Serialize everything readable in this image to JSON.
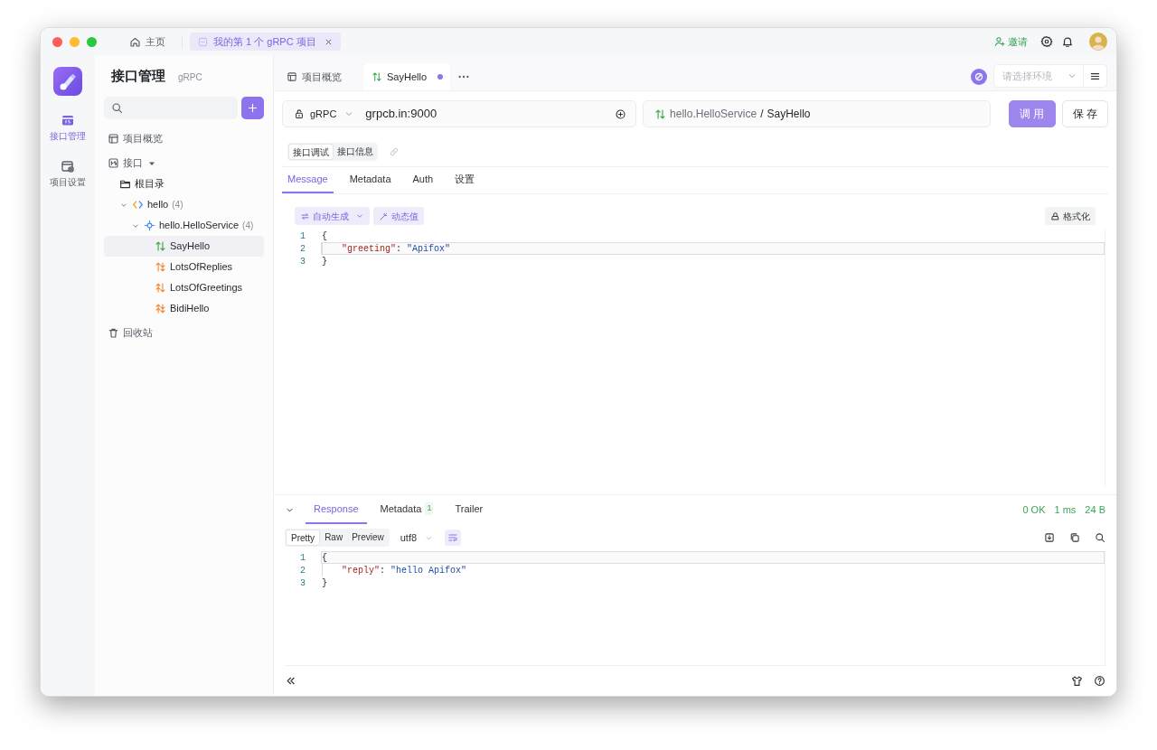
{
  "title_bar": {
    "tabs": [
      {
        "label": "主页",
        "kind": "home",
        "selected": false
      },
      {
        "label": "我的第 1 个 gRPC 项目",
        "kind": "project",
        "selected": true,
        "closable": true
      }
    ],
    "invite": "邀请"
  },
  "rail": {
    "items": [
      {
        "label": "接口管理",
        "kind": "api",
        "selected": true
      },
      {
        "label": "项目设置",
        "kind": "settings",
        "selected": false
      }
    ]
  },
  "sidebar": {
    "title": "接口管理",
    "subtitle": "gRPC",
    "tree": [
      {
        "label": "项目概览",
        "kind": "overview"
      },
      {
        "label": "接口",
        "kind": "api",
        "expanded": true,
        "children": [
          {
            "label": "根目录",
            "kind": "folder"
          },
          {
            "label": "hello",
            "count": "(4)",
            "kind": "package",
            "expanded": true,
            "children": [
              {
                "label": "hello.HelloService",
                "count": "(4)",
                "kind": "service",
                "expanded": true,
                "children": [
                  {
                    "label": "SayHello",
                    "kind": "unary",
                    "selected": true
                  },
                  {
                    "label": "LotsOfReplies",
                    "kind": "server_stream",
                    "selected": false
                  },
                  {
                    "label": "LotsOfGreetings",
                    "kind": "client_stream",
                    "selected": false
                  },
                  {
                    "label": "BidiHello",
                    "kind": "bidi",
                    "selected": false
                  }
                ]
              }
            ]
          }
        ]
      },
      {
        "label": "回收站",
        "kind": "trash"
      }
    ]
  },
  "main": {
    "tabs": [
      {
        "label": "项目概览",
        "kind": "overview",
        "selected": false
      },
      {
        "label": "SayHello",
        "kind": "unary",
        "selected": true,
        "unsaved": true
      }
    ],
    "environment": {
      "placeholder": "请选择环境"
    },
    "request": {
      "protocol": "gRPC",
      "url": "grpcb.in:9000",
      "service": "hello.HelloService",
      "separator": "/",
      "method": {
        "label": "SayHello",
        "kind": "unary"
      },
      "buttons": [
        {
          "label": "调 用",
          "kind": "primary"
        },
        {
          "label": "保 存",
          "kind": "secondary"
        }
      ]
    },
    "modes": [
      {
        "label": "接口调试",
        "selected": true
      },
      {
        "label": "接口信息",
        "selected": false
      }
    ],
    "request_tabs": [
      {
        "label": "Message",
        "selected": true
      },
      {
        "label": "Metadata",
        "selected": false
      },
      {
        "label": "Auth",
        "selected": false
      },
      {
        "label": "设置",
        "selected": false
      }
    ],
    "message_toolbar": {
      "generate": "自动生成",
      "dynamic": "动态值",
      "format": "格式化"
    },
    "message_editor": {
      "lines": [
        {
          "number": "1",
          "active": false,
          "indented": false,
          "tokens": [
            {
              "text": "{",
              "kind": "punct"
            }
          ]
        },
        {
          "number": "2",
          "active": true,
          "indented": true,
          "tokens": [
            {
              "text": "\"greeting\"",
              "kind": "key"
            },
            {
              "text": ": ",
              "kind": "punct"
            },
            {
              "text": "\"Apifox\"",
              "kind": "string"
            }
          ]
        },
        {
          "number": "3",
          "active": false,
          "indented": false,
          "tokens": [
            {
              "text": "}",
              "kind": "punct"
            }
          ]
        }
      ]
    },
    "response": {
      "tabs": [
        {
          "label": "Response",
          "selected": true
        },
        {
          "label": "Metadata",
          "badge": "1",
          "selected": false
        },
        {
          "label": "Trailer",
          "selected": false
        }
      ],
      "status": "0 OK",
      "time": "1 ms",
      "size": "24 B",
      "views": [
        {
          "label": "Pretty",
          "selected": true
        },
        {
          "label": "Raw",
          "selected": false
        },
        {
          "label": "Preview",
          "selected": false
        }
      ],
      "encoding": "utf8",
      "lines": [
        {
          "number": "1",
          "active": true,
          "indented": false,
          "tokens": [
            {
              "text": "{",
              "kind": "punct"
            }
          ]
        },
        {
          "number": "2",
          "active": false,
          "indented": true,
          "tokens": [
            {
              "text": "\"reply\"",
              "kind": "key"
            },
            {
              "text": ": ",
              "kind": "punct"
            },
            {
              "text": "\"hello Apifox\"",
              "kind": "string"
            }
          ]
        },
        {
          "number": "3",
          "active": false,
          "indented": false,
          "tokens": [
            {
              "text": "}",
              "kind": "punct"
            }
          ]
        }
      ]
    }
  }
}
